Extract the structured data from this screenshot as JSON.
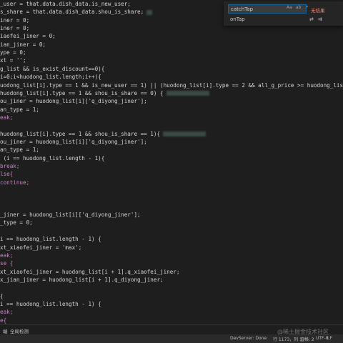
{
  "code_lines": [
    {
      "segments": [
        {
          "t": "_user = that.data.dish_data.is_new_user;",
          "c": ""
        }
      ]
    },
    {
      "segments": [
        {
          "t": "s_share = that.data.dish_data.shou_is_share;",
          "c": ""
        }
      ],
      "blur": "small"
    },
    {
      "segments": [
        {
          "t": "iner = 0;",
          "c": ""
        }
      ]
    },
    {
      "segments": [
        {
          "t": "iner = 0;",
          "c": ""
        }
      ]
    },
    {
      "segments": [
        {
          "t": "iaofei_jiner = 0;",
          "c": ""
        }
      ]
    },
    {
      "segments": [
        {
          "t": "ian_jiner = 0;",
          "c": ""
        }
      ]
    },
    {
      "segments": [
        {
          "t": "ype = 0;",
          "c": ""
        }
      ]
    },
    {
      "segments": [
        {
          "t": "xt = '';",
          "c": ""
        }
      ]
    },
    {
      "segments": [
        {
          "t": "g_list && is_exist_discount==0){",
          "c": ""
        }
      ]
    },
    {
      "segments": [
        {
          "t": "i=0;i<huodong_list.length;i++){",
          "c": ""
        }
      ]
    },
    {
      "segments": [
        {
          "t": "uodong_list[i].type == 1 && is_new_user == 1) || (huodong_list[i].type == 2 && all_g_price >= huodong_list",
          "c": ""
        }
      ]
    },
    {
      "segments": [
        {
          "t": "huodong_list[i].type == 1 && shou_is_share == 0) {",
          "c": ""
        }
      ],
      "blur": "wide"
    },
    {
      "segments": [
        {
          "t": "ou_jiner = huodong_list[i]['q_diyong_jiner'];",
          "c": ""
        }
      ]
    },
    {
      "segments": [
        {
          "t": "an_type = 1;",
          "c": ""
        }
      ]
    },
    {
      "segments": [
        {
          "t": "eak;",
          "c": "kw"
        }
      ]
    },
    {
      "segments": [
        {
          "t": "",
          "c": ""
        }
      ]
    },
    {
      "segments": [
        {
          "t": "huodong_list[i].type == 1 && shou_is_share == 1){",
          "c": ""
        }
      ],
      "blur": "wide"
    },
    {
      "segments": [
        {
          "t": "ou_jiner = huodong_list[i]['q_diyong_jiner'];",
          "c": ""
        }
      ]
    },
    {
      "segments": [
        {
          "t": "an_type = 1;",
          "c": ""
        }
      ]
    },
    {
      "segments": [
        {
          "t": " (i == huodong_list.length - 1){",
          "c": ""
        }
      ]
    },
    {
      "segments": [
        {
          "t": "break;",
          "c": "kw"
        }
      ]
    },
    {
      "segments": [
        {
          "t": "lse{",
          "c": "kw"
        }
      ]
    },
    {
      "segments": [
        {
          "t": "continue;",
          "c": "kw"
        }
      ]
    },
    {
      "segments": [
        {
          "t": "",
          "c": ""
        }
      ]
    },
    {
      "segments": [
        {
          "t": "",
          "c": ""
        }
      ]
    },
    {
      "segments": [
        {
          "t": "",
          "c": ""
        }
      ]
    },
    {
      "segments": [
        {
          "t": "_jiner = huodong_list[i]['q_diyong_jiner'];",
          "c": ""
        }
      ]
    },
    {
      "segments": [
        {
          "t": "_type = 0;",
          "c": ""
        }
      ]
    },
    {
      "segments": [
        {
          "t": "",
          "c": ""
        }
      ]
    },
    {
      "segments": [
        {
          "t": "i == huodong_list.length - 1) {",
          "c": ""
        }
      ]
    },
    {
      "segments": [
        {
          "t": "xt_xiaofei_jiner = 'max';",
          "c": ""
        }
      ]
    },
    {
      "segments": [
        {
          "t": "eak;",
          "c": "kw"
        }
      ]
    },
    {
      "segments": [
        {
          "t": "se {",
          "c": "kw"
        }
      ]
    },
    {
      "segments": [
        {
          "t": "xt_xiaofei_jiner = huodong_list[i + 1].q_xiaofei_jiner;",
          "c": ""
        }
      ]
    },
    {
      "segments": [
        {
          "t": "x_jian_jiner = huodong_list[i + 1].q_diyong_jiner;",
          "c": ""
        }
      ]
    },
    {
      "segments": [
        {
          "t": "",
          "c": ""
        }
      ]
    },
    {
      "segments": [
        {
          "t": "{",
          "c": ""
        }
      ]
    },
    {
      "segments": [
        {
          "t": "i == huodong_list.length - 1) {",
          "c": ""
        }
      ]
    },
    {
      "segments": [
        {
          "t": "eak;",
          "c": "kw"
        }
      ]
    },
    {
      "segments": [
        {
          "t": "e{",
          "c": "kw"
        }
      ]
    }
  ],
  "find_widget": {
    "search_value": "catchTap",
    "replace_value": "onTap",
    "opt_case": "Aa",
    "opt_word": "ab",
    "opt_regex": ".*",
    "result_text": "无结果"
  },
  "panel": {
    "tab1": "端",
    "tab2": "全局检测"
  },
  "status": {
    "devserver": "DevServer: Done",
    "position": "行 1173，列 17",
    "spaces": "空格: 2",
    "encoding": "UTF-8",
    "eol": "LF",
    "lang": "JavaScript"
  },
  "watermark": "@稀土掘金技术社区"
}
